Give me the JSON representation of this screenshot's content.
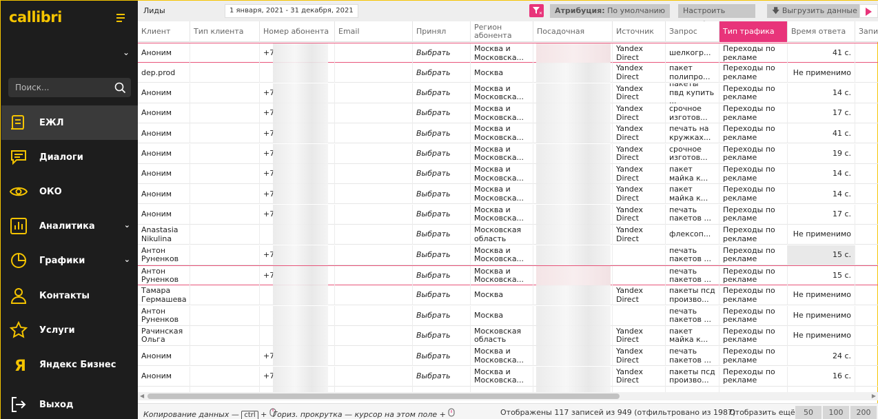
{
  "sidebar": {
    "logo": "callibri",
    "search_placeholder": "Поиск...",
    "items": [
      {
        "label": "ЕЖЛ",
        "icon": "journal-icon",
        "active": true
      },
      {
        "label": "Диалоги",
        "icon": "chat-icon"
      },
      {
        "label": "ОКО",
        "icon": "eye-icon"
      },
      {
        "label": "Аналитика",
        "icon": "bar-chart-icon",
        "chevron": true
      },
      {
        "label": "Графики",
        "icon": "pie-chart-icon",
        "chevron": true
      },
      {
        "label": "Контакты",
        "icon": "person-icon"
      },
      {
        "label": "Услуги",
        "icon": "star-icon"
      },
      {
        "label": "Яндекс Бизнес",
        "icon": "yandex-icon"
      },
      {
        "label": "Выход",
        "icon": "logout-icon"
      }
    ]
  },
  "topbar": {
    "title": "Лиды",
    "date_range": "1 января, 2021 - 31 декабря, 2021",
    "attribution_label": "Атрибуция:",
    "attribution_value": "По умолчанию",
    "configure_columns": "Настроить столбцы",
    "export": "Выгрузить данные"
  },
  "columns": [
    "Клиент",
    "Тип клиента",
    "Номер абонента",
    "Email",
    "Принял",
    "Регион абонента",
    "Посадочная",
    "Источник",
    "Запрос",
    "Тип трафика",
    "Время ответа",
    "Запи"
  ],
  "rows": [
    {
      "client": "Аноним",
      "phone": "+7",
      "accepted": "Выбрать",
      "region": "Москва и Московска...",
      "source": "Yandex Direct",
      "query": "шелкогр...",
      "traffic": "Переходы по рекламе",
      "time": "41 с.",
      "red": true
    },
    {
      "client": "dep.prod",
      "phone": "",
      "accepted": "Выбрать",
      "region": "Москва",
      "source": "Yandex Direct",
      "query": "пакет полипро...",
      "traffic": "Переходы по рекламе",
      "time": "Не применимо"
    },
    {
      "client": "Аноним",
      "phone": "+7",
      "accepted": "Выбрать",
      "region": "Москва и Московска...",
      "source": "Yandex Direct",
      "query": "пакеты пвд купить ...",
      "traffic": "Переходы по рекламе",
      "time": "14 с."
    },
    {
      "client": "Аноним",
      "phone": "+7",
      "accepted": "Выбрать",
      "region": "Москва и Московска...",
      "source": "Yandex Direct",
      "query": "срочное изготов...",
      "traffic": "Переходы по рекламе",
      "time": "17 с."
    },
    {
      "client": "Аноним",
      "phone": "+7",
      "accepted": "Выбрать",
      "region": "Москва и Московска...",
      "source": "Yandex Direct",
      "query": "печать на кружках...",
      "traffic": "Переходы по рекламе",
      "time": "41 с."
    },
    {
      "client": "Аноним",
      "phone": "+7",
      "accepted": "Выбрать",
      "region": "Москва и Московска...",
      "source": "Yandex Direct",
      "query": "срочное изготов...",
      "traffic": "Переходы по рекламе",
      "time": "19 с."
    },
    {
      "client": "Аноним",
      "phone": "+7",
      "accepted": "Выбрать",
      "region": "Москва и Московска...",
      "source": "Yandex Direct",
      "query": "пакет майка к...",
      "traffic": "Переходы по рекламе",
      "time": "14 с."
    },
    {
      "client": "Аноним",
      "phone": "+7",
      "accepted": "Выбрать",
      "region": "Москва и Московска...",
      "source": "Yandex Direct",
      "query": "пакет майка к...",
      "traffic": "Переходы по рекламе",
      "time": "14 с."
    },
    {
      "client": "Аноним",
      "phone": "+7",
      "accepted": "Выбрать",
      "region": "Москва и Московска...",
      "source": "Yandex Direct",
      "query": "печать пакетов ...",
      "traffic": "Переходы по рекламе",
      "time": "17 с."
    },
    {
      "client": "Anastasia Nikulina",
      "phone": "",
      "accepted": "Выбрать",
      "region": "Московская область",
      "source": "Yandex Direct",
      "query": "флексоп...",
      "traffic": "Переходы по рекламе",
      "time": "Не применимо"
    },
    {
      "client": "Антон Руненков",
      "phone": "+7",
      "accepted": "Выбрать",
      "region": "Москва и Московска...",
      "source": "",
      "query": "печать пакетов ...",
      "traffic": "Переходы по рекламе",
      "time": "15 с.",
      "shade": true
    },
    {
      "client": "Антон Руненков",
      "phone": "+7",
      "accepted": "Выбрать",
      "region": "Москва и Московска...",
      "source": "",
      "query": "печать пакетов ...",
      "traffic": "Переходы по рекламе",
      "time": "15 с.",
      "red": true
    },
    {
      "client": "Тамара Гермашева",
      "phone": "",
      "accepted": "Выбрать",
      "region": "Москва",
      "source": "Yandex Direct",
      "query": "пакеты псд произво...",
      "traffic": "Переходы по рекламе",
      "time": "Не применимо"
    },
    {
      "client": "Антон Руненков",
      "phone": "",
      "accepted": "Выбрать",
      "region": "Москва",
      "source": "",
      "query": "печать пакетов ...",
      "traffic": "Переходы по рекламе",
      "time": "Не применимо"
    },
    {
      "client": "Рачинская Ольга",
      "phone": "",
      "accepted": "Выбрать",
      "region": "Московская область",
      "source": "Yandex Direct",
      "query": "пакет майка к...",
      "traffic": "Переходы по рекламе",
      "time": "Не применимо"
    },
    {
      "client": "Аноним",
      "phone": "+7",
      "accepted": "Выбрать",
      "region": "Москва и Московска...",
      "source": "Yandex Direct",
      "query": "печать пакетов ...",
      "traffic": "Переходы по рекламе",
      "time": "24 с."
    },
    {
      "client": "Аноним",
      "phone": "+7",
      "accepted": "Выбрать",
      "region": "Москва и Московска...",
      "source": "Yandex Direct",
      "query": "пакеты псд произво...",
      "traffic": "Переходы по рекламе",
      "time": "16 с."
    },
    {
      "client": "",
      "phone": "",
      "accepted": "",
      "region": "Москва и",
      "source": "",
      "query": "печать на",
      "traffic": "Переходы по",
      "time": ""
    }
  ],
  "footer": {
    "copy_label": "Копирование данных —",
    "ctrl": "ctrl",
    "plus": "+",
    "scroll_label": "Гориз. прокрутка — курсор на этом поле +",
    "status": "Отображены 117 записей из 949 (отфильтровано из 1987)",
    "show_more": "Отобразить ещё:",
    "pages": [
      "50",
      "100",
      "200"
    ]
  },
  "colors": {
    "accent": "#f5c400",
    "pink": "#e8347a",
    "sidebar": "#1d1d1d"
  }
}
